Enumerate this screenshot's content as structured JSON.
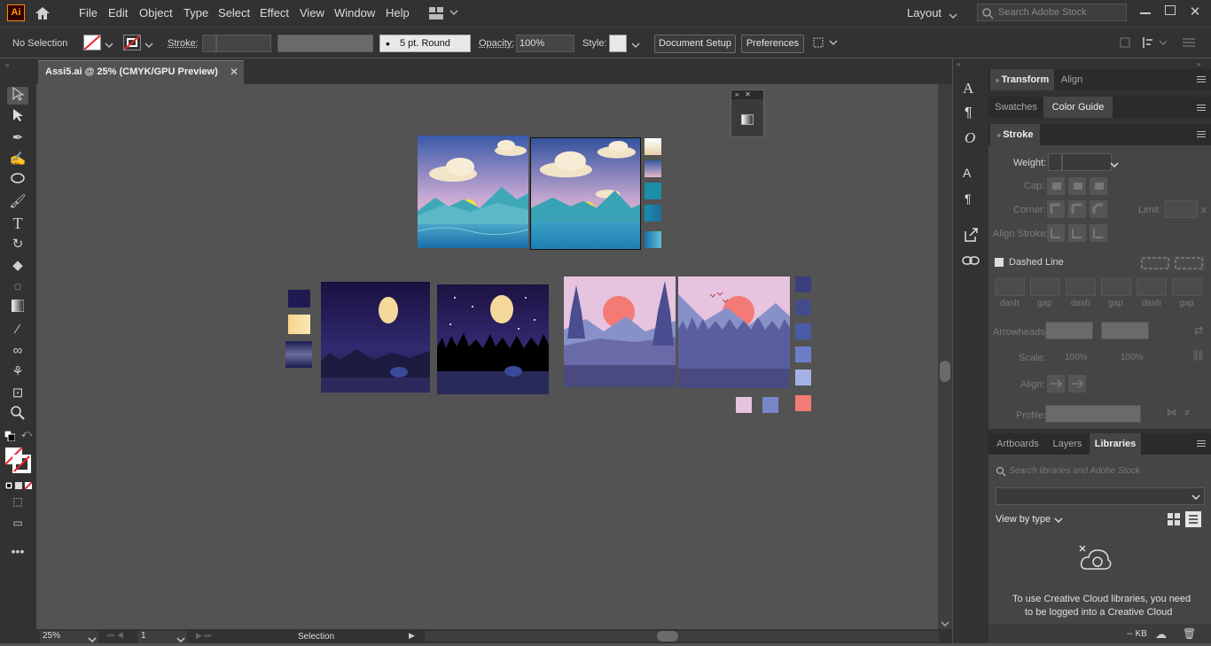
{
  "app": {
    "logo": "Ai"
  },
  "menu": [
    "File",
    "Edit",
    "Object",
    "Type",
    "Select",
    "Effect",
    "View",
    "Window",
    "Help"
  ],
  "workspace": {
    "label": "Layout"
  },
  "search": {
    "placeholder": "Search Adobe Stock"
  },
  "options": {
    "selection": "No Selection",
    "stroke_label": "Stroke:",
    "brush": "5 pt. Round",
    "opacity_label": "Opacity:",
    "opacity_value": "100%",
    "style_label": "Style:",
    "doc_setup": "Document Setup",
    "preferences": "Preferences"
  },
  "document": {
    "tab_title": "Assi5.ai @ 25% (CMYK/GPU Preview)"
  },
  "status": {
    "zoom": "25%",
    "artboard": "1",
    "tool": "Selection"
  },
  "panels": {
    "tabs_top": [
      "Transform",
      "Align"
    ],
    "tabs_second": [
      "Swatches",
      "Color Guide"
    ],
    "stroke_title": "Stroke",
    "weight_label": "Weight:",
    "cap_label": "Cap:",
    "corner_label": "Corner:",
    "limit_label": "Limit:",
    "limit_x": "x",
    "align_stroke_label": "Align Stroke:",
    "dashed_line": "Dashed Line",
    "dash_labels": [
      "dash",
      "gap",
      "dash",
      "gap",
      "dash",
      "gap"
    ],
    "arrowheads_label": "Arrowheads:",
    "scale_label": "Scale:",
    "scale_values": [
      "100%",
      "100%"
    ],
    "align_label": "Align:",
    "profile_label": "Profile:",
    "tabs_bottom": [
      "Artboards",
      "Layers",
      "Libraries"
    ],
    "lib_search_placeholder": "Search libraries and Adobe Stock",
    "view_by": "View by type",
    "cc_message_line1": "To use Creative Cloud libraries, you need",
    "cc_message_line2": "to be logged into a Creative Cloud",
    "footer_kb": "-- KB"
  },
  "colors": {
    "ui_dark": "#323232",
    "canvas": "#535353",
    "accent_red": "#e8262b"
  }
}
